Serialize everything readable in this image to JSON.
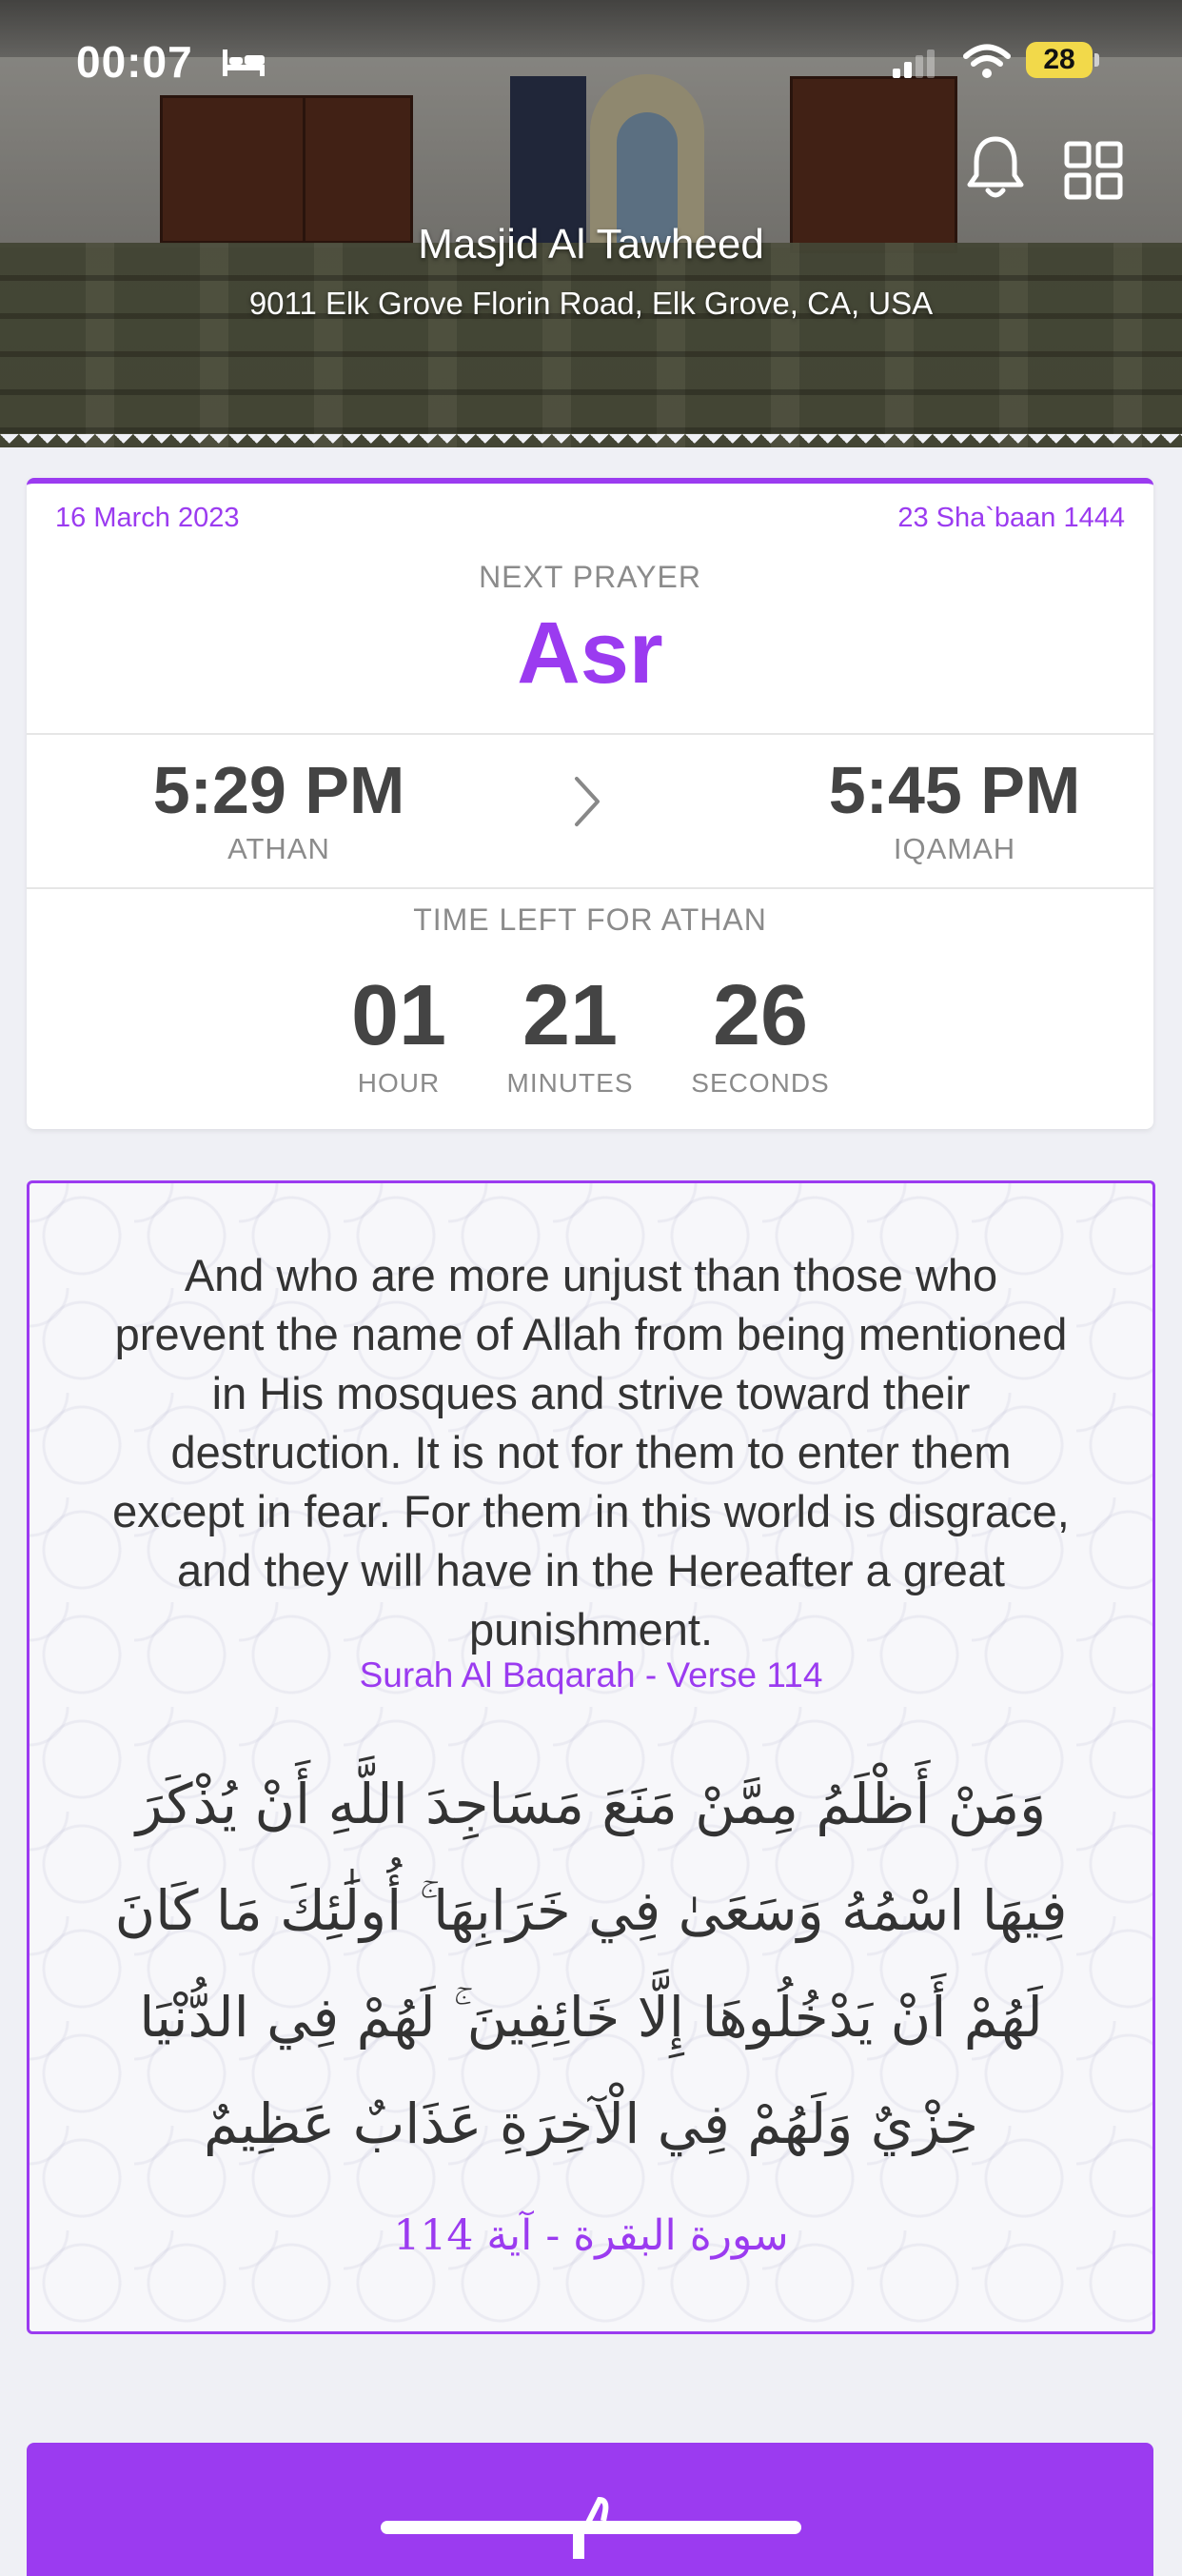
{
  "status_bar": {
    "time": "00:07",
    "battery": "28"
  },
  "header": {
    "masjid_name": "Masjid Al Tawheed",
    "address": "9011 Elk Grove Florin Road, Elk Grove, CA, USA"
  },
  "prayer_card": {
    "gregorian_date": "16 March 2023",
    "hijri_date": "23 Sha`baan 1444",
    "next_prayer_label": "NEXT PRAYER",
    "next_prayer_name": "Asr",
    "athan_time": "5:29 PM",
    "athan_label": "ATHAN",
    "iqamah_time": "5:45 PM",
    "iqamah_label": "IQAMAH",
    "time_left_label": "TIME LEFT FOR ATHAN",
    "countdown": [
      {
        "value": "01",
        "label": "HOUR"
      },
      {
        "value": "21",
        "label": "MINUTES"
      },
      {
        "value": "26",
        "label": "SECONDS"
      }
    ]
  },
  "verse": {
    "english": "And who are more unjust than those who prevent the name of Allah from being mentioned in His mosques and strive toward their destruction. It is not for them to enter them except in fear. For them in this world is disgrace, and they will have in the Hereafter a great punishment.",
    "reference": "Surah Al Baqarah - Verse 114",
    "arabic": "وَمَنْ أَظْلَمُ مِمَّنْ مَنَعَ مَسَاجِدَ اللَّهِ أَنْ يُذْكَرَ فِيهَا اسْمُهُ وَسَعَىٰ فِي خَرَابِهَا ۚ أُولَٰئِكَ مَا كَانَ لَهُمْ أَنْ يَدْخُلُوهَا إِلَّا خَائِفِينَ ۚ لَهُمْ فِي الدُّنْيَا خِزْيٌ وَلَهُمْ فِي الْآخِرَةِ عَذَابٌ عَظِيمٌ",
    "arabic_reference": "سورة البقرة - آية 114"
  },
  "icons": {
    "bell": "bell-icon",
    "grid": "grid-icon",
    "chevron": "chevron-right-icon"
  },
  "colors": {
    "accent": "#9b3bf0",
    "background": "#eff0f5"
  }
}
